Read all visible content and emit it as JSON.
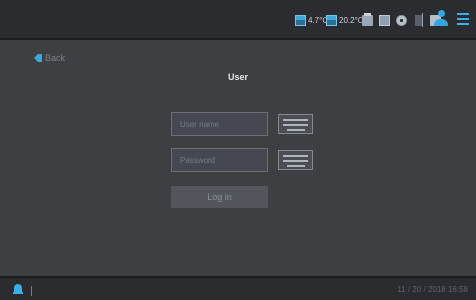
{
  "header": {
    "temp1": "4.7°C",
    "temp2": "20.2°C",
    "icons": [
      "tank-icon",
      "tank-icon",
      "printer-icon",
      "storage-icon",
      "disc-icon",
      "usb-icon",
      "card-icon",
      "user-icon",
      "menu-icon"
    ],
    "accent_color": "#33a6e0"
  },
  "nav": {
    "back_label": "Back"
  },
  "page": {
    "title": "User"
  },
  "form": {
    "username_placeholder": "User name",
    "password_placeholder": "Password",
    "login_label": "Log in"
  },
  "footer": {
    "datetime": "11 / 20 / 2018 16:58"
  }
}
